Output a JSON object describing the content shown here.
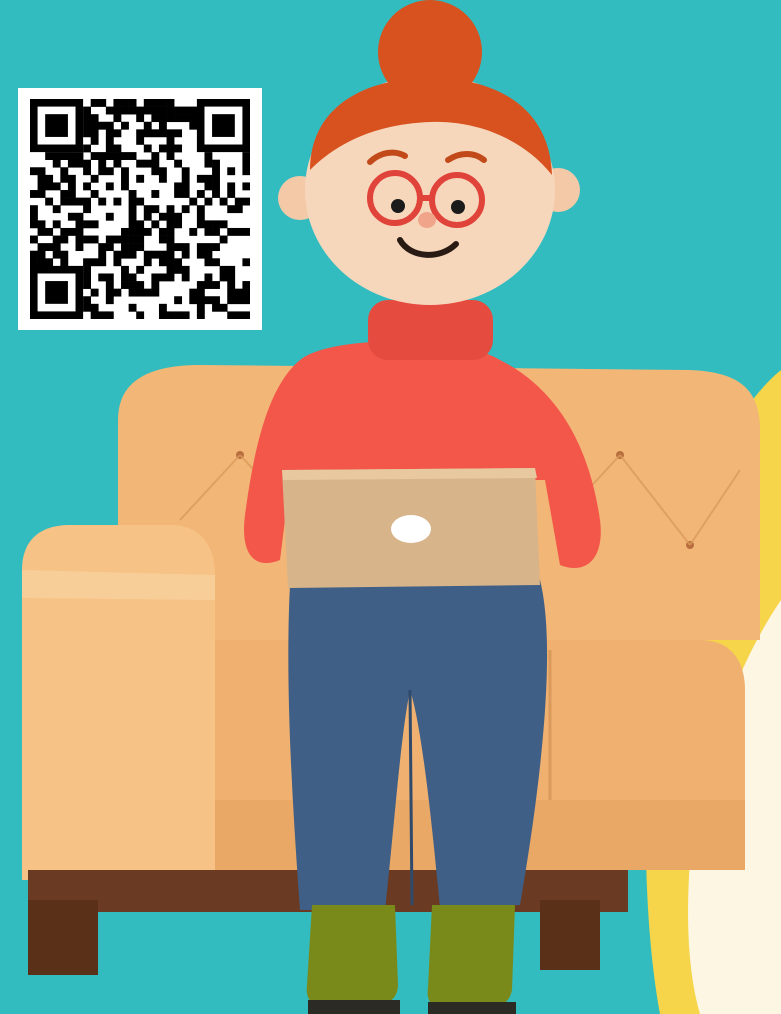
{
  "page": {
    "background_color": "#33bcc0"
  },
  "qr_code": {
    "icon": "qr-code-icon",
    "modules": 29,
    "pattern_seed": 7331
  },
  "illustration": {
    "subject": "person-on-sofa",
    "colors": {
      "sofa": "#f2b777",
      "sofa_shadow": "#d99a5c",
      "sofa_legs": "#6a3a22",
      "sweater": "#f2574a",
      "sweater_shadow": "#d9443a",
      "skin": "#f7d7bc",
      "hair": "#d7521e",
      "glasses": "#e0433a",
      "laptop": "#d8b48a",
      "jeans": "#3f5f86",
      "boots": "#7a8a1a",
      "blob_yellow": "#f6d54a",
      "blob_cream": "#fdf6e3"
    }
  }
}
